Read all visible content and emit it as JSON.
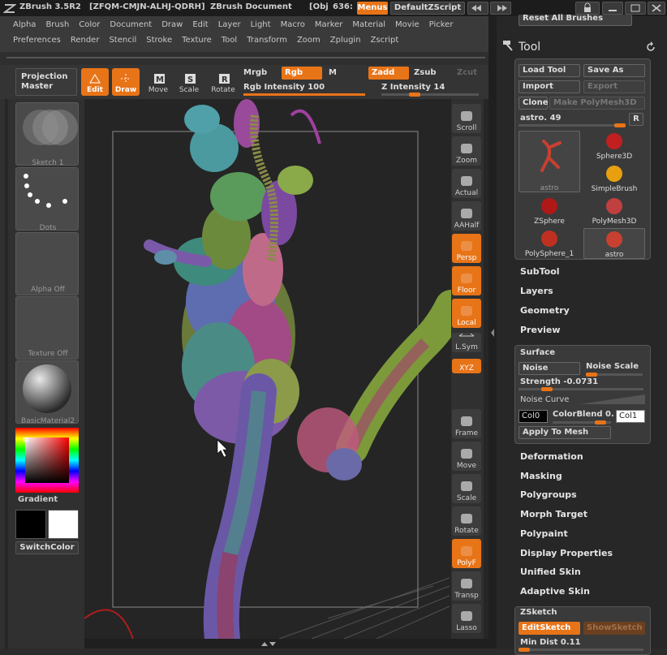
{
  "title_bar": {
    "app": "ZBrush 3.5R2",
    "key": "[ZFQM-CMJN-ALHJ-QDRH]",
    "doc": "ZBrush Document",
    "obj": "[Obj",
    "obj_count": "636:",
    "menus": "Menus",
    "zscript": "DefaultZScript"
  },
  "menu_row1": [
    "Alpha",
    "Brush",
    "Color",
    "Document",
    "Draw",
    "Edit",
    "Layer",
    "Light",
    "Macro",
    "Marker",
    "Material",
    "Movie",
    "Picker"
  ],
  "menu_row2": [
    "Preferences",
    "Render",
    "Stencil",
    "Stroke",
    "Texture",
    "Tool",
    "Transform",
    "Zoom",
    "Zplugin",
    "Zscript"
  ],
  "toolbar": {
    "projection": "Projection Master",
    "edit": "Edit",
    "draw": "Draw",
    "move": "Move",
    "scale": "Scale",
    "rotate": "Rotate",
    "mrgb": "Mrgb",
    "rgb": "Rgb",
    "m": "M",
    "zadd": "Zadd",
    "zsub": "Zsub",
    "zcut": "Zcut",
    "rgb_intensity": "Rgb Intensity 100",
    "z_intensity": "Z Intensity 14",
    "rgb_intensity_level": 1.0,
    "z_intensity_level": 0.14
  },
  "left_shelf": {
    "brush": "Sketch 1",
    "stroke": "Dots",
    "alpha": "Alpha Off",
    "texture": "Texture Off",
    "material": "BasicMaterial2",
    "gradient": "Gradient",
    "switch": "SwitchColor"
  },
  "right_shelf": [
    "Scroll",
    "Zoom",
    "Actual",
    "AAHalf",
    "Persp",
    "Floor",
    "Local",
    "L.Sym",
    "XYZ",
    "Frame",
    "Move",
    "Scale",
    "Rotate",
    "PolyF",
    "Transp",
    "Lasso"
  ],
  "panel": {
    "reset": "Reset All Brushes",
    "tool_title": "Tool",
    "load": "Load Tool",
    "save": "Save As",
    "import": "Import",
    "export": "Export",
    "clone": "Clone",
    "make_poly": "Make PolyMesh3D",
    "tool_name": "astro. 49",
    "r": "R",
    "tools": [
      {
        "label": "astro"
      },
      {
        "label": "Sphere3D"
      },
      {
        "label": "SimpleBrush"
      },
      {
        "label": "ZSphere"
      },
      {
        "label": "PolyMesh3D"
      },
      {
        "label": "PolySphere_1"
      },
      {
        "label": "astro"
      }
    ],
    "sections_top": [
      "SubTool",
      "Layers",
      "Geometry",
      "Preview"
    ],
    "surface": {
      "title": "Surface",
      "noise": "Noise",
      "noise_scale": "Noise Scale",
      "strength": "Strength -0.0731",
      "noise_curve": "Noise Curve",
      "col0": "Col0",
      "colorblend": "ColorBlend 0.",
      "col1": "Col1",
      "apply": "Apply To Mesh"
    },
    "sections_bottom": [
      "Deformation",
      "Masking",
      "Polygroups",
      "Morph Target",
      "Polypaint",
      "Display Properties",
      "Unified Skin",
      "Adaptive Skin"
    ],
    "zsketch": {
      "title": "ZSketch",
      "edit": "EditSketch",
      "show": "ShowSketch",
      "min_dist": "Min Dist 0.11"
    }
  },
  "colors": {
    "accent": "#e87418",
    "panel": "#272727",
    "shelf": "#303030"
  }
}
